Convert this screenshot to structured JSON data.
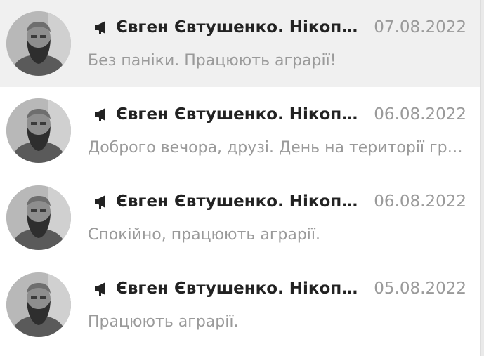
{
  "chats": [
    {
      "name": "Євген Євтушенко. Нікопольська РВА",
      "date": "07.08.2022",
      "preview": "Без паніки. Працюють аграрії!",
      "active": true,
      "type_icon": "megaphone-icon"
    },
    {
      "name": "Євген Євтушенко. Нікопольська РВА",
      "date": "06.08.2022",
      "preview": "Доброго вечора, друзі.  День на території громад",
      "active": false,
      "type_icon": "megaphone-icon"
    },
    {
      "name": "Євген Євтушенко. Нікопольська РВА",
      "date": "06.08.2022",
      "preview": "Спокійно, працюють аграрії.",
      "active": false,
      "type_icon": "megaphone-icon"
    },
    {
      "name": "Євген Євтушенко. Нікопольська РВА",
      "date": "05.08.2022",
      "preview": "Працюють аграрії.",
      "active": false,
      "type_icon": "megaphone-icon"
    }
  ],
  "colors": {
    "active_background": "#f0f0f0",
    "name_text": "#222222",
    "muted_text": "#9a9a9a"
  }
}
